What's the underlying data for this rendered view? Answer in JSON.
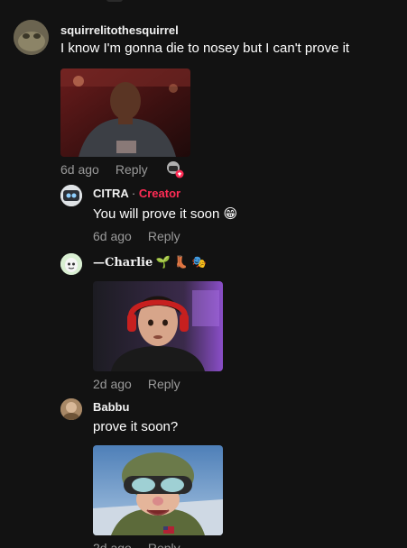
{
  "comments": [
    {
      "username": "squirrelitothesquirrel",
      "text": "I know I'm gonna die to nosey but I can't prove it",
      "time": "6d ago",
      "reply": "Reply",
      "icon": "liked-by-creator-icon"
    },
    {
      "username": "CITRA",
      "separator": "·",
      "badge": "Creator",
      "text": "You will prove it soon",
      "emoji": "😁",
      "time": "6d ago",
      "reply": "Reply"
    },
    {
      "username": "—Charlie",
      "username_emojis": "🌱 👢 🎭",
      "time": "2d ago",
      "reply": "Reply"
    },
    {
      "username": "Babbu",
      "text": "prove it soon?",
      "time": "2d ago",
      "reply": "Reply"
    }
  ],
  "colors": {
    "background": "#121212",
    "creator_badge": "#fe2c55",
    "meta_text": "#9a9a9a"
  }
}
